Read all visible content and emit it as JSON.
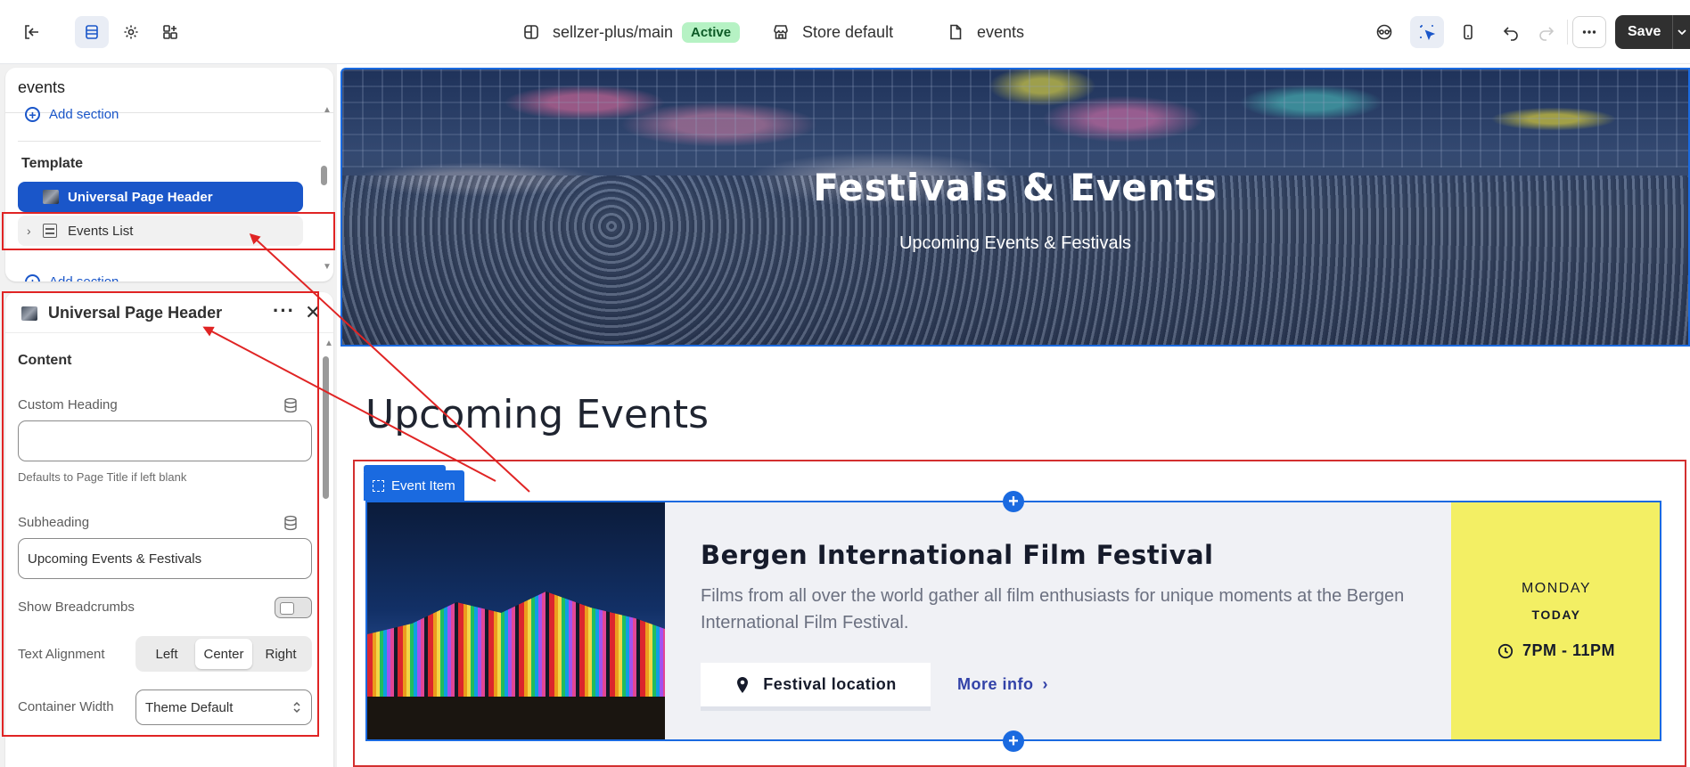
{
  "topbar": {
    "store_path": "sellzer-plus/main",
    "status_badge": "Active",
    "store_label": "Store default",
    "page_label": "events",
    "save_label": "Save",
    "icons": [
      "exit-icon",
      "sections-icon",
      "gear-icon",
      "apps-icon",
      "branch-icon",
      "store-icon",
      "page-icon",
      "preview-eye-icon",
      "inspector-icon",
      "mobile-icon",
      "undo-icon",
      "redo-icon",
      "more-icon"
    ]
  },
  "sidebar": {
    "page_name": "events",
    "add_section_top": "Add section",
    "template_label": "Template",
    "items": [
      {
        "label": "Universal Page Header"
      },
      {
        "label": "Events List"
      }
    ],
    "add_section_bottom": "Add section"
  },
  "settings": {
    "title": "Universal Page Header",
    "section_label": "Content",
    "custom_heading_label": "Custom Heading",
    "custom_heading_value": "",
    "custom_heading_help": "Defaults to Page Title if left blank",
    "subheading_label": "Subheading",
    "subheading_value": "Upcoming Events & Festivals",
    "breadcrumbs_label": "Show Breadcrumbs",
    "breadcrumbs_on": false,
    "alignment_label": "Text Alignment",
    "alignment_options": [
      "Left",
      "Center",
      "Right"
    ],
    "alignment_selected": "Center",
    "width_label": "Container Width",
    "width_value": "Theme Default"
  },
  "preview": {
    "hero_title": "Festivals & Events",
    "hero_subtitle": "Upcoming Events & Festivals",
    "section_heading": "Upcoming Events",
    "block_tag": "Event Item",
    "event": {
      "title": "Bergen International Film Festival",
      "description": "Films from all over the world gather all film enthusiasts for unique moments at the Bergen International Film Festival.",
      "location_button": "Festival location",
      "more_info": "More info",
      "day": "MONDAY",
      "date_label": "TODAY",
      "time": "7PM - 11PM"
    }
  },
  "colors": {
    "accent": "#1a56c9",
    "selection_blue": "#1a6ae0",
    "annotation_red": "#e02424",
    "badge_green": "#b6f2c4",
    "date_panel_yellow": "#f3ef64",
    "link_indigo": "#3242a8"
  }
}
